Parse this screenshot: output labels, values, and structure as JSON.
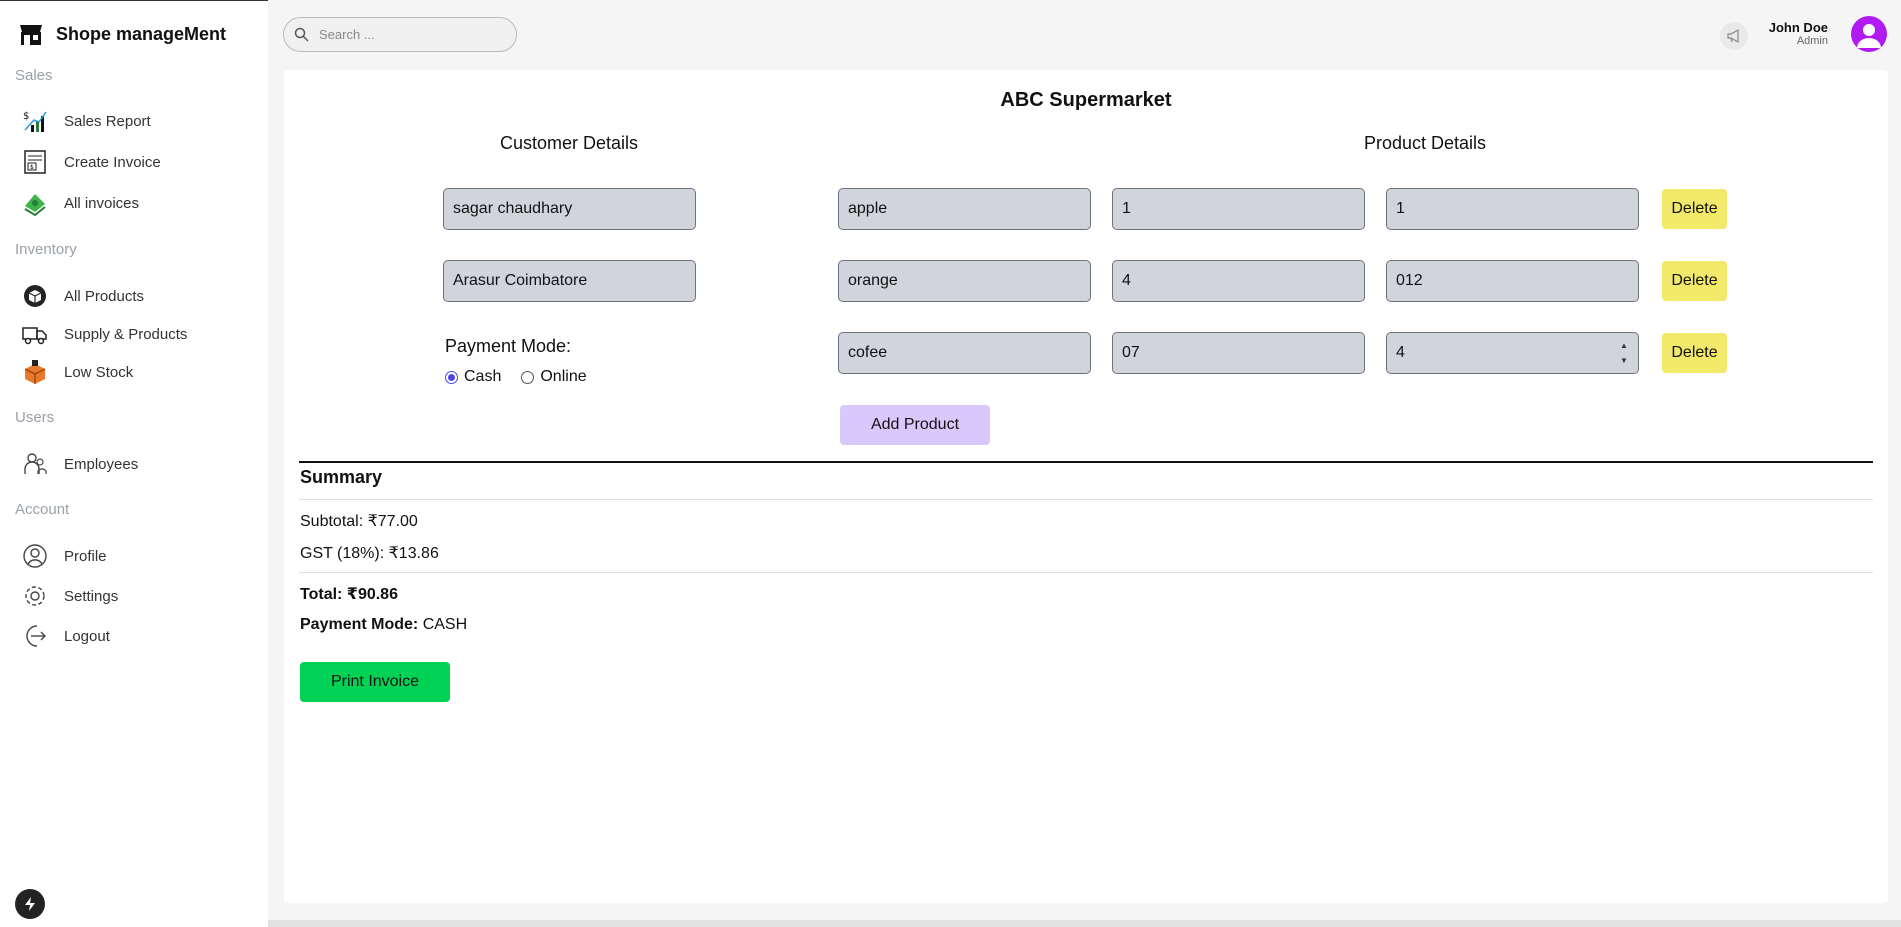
{
  "app": {
    "title": "Shope manageMent"
  },
  "search": {
    "placeholder": "Search ..."
  },
  "sidebar": {
    "sections": [
      {
        "label": "Sales",
        "items": [
          {
            "label": "Sales Report",
            "icon": "chart-bars-icon"
          },
          {
            "label": "Create Invoice",
            "icon": "invoice-icon"
          },
          {
            "label": "All invoices",
            "icon": "money-stack-icon"
          }
        ]
      },
      {
        "label": "Inventory",
        "items": [
          {
            "label": "All Products",
            "icon": "box-icon"
          },
          {
            "label": "Supply & Products",
            "icon": "truck-icon"
          },
          {
            "label": "Low Stock",
            "icon": "stock-box-icon"
          }
        ]
      },
      {
        "label": "Users",
        "items": [
          {
            "label": "Employees",
            "icon": "users-icon"
          }
        ]
      },
      {
        "label": "Account",
        "items": [
          {
            "label": "Profile",
            "icon": "user-circle-icon"
          },
          {
            "label": "Settings",
            "icon": "gear-icon"
          },
          {
            "label": "Logout",
            "icon": "logout-icon"
          }
        ]
      }
    ]
  },
  "user": {
    "name": "John Doe",
    "role": "Admin"
  },
  "invoice": {
    "store_name": "ABC Supermarket",
    "customer_heading": "Customer Details",
    "product_heading": "Product Details",
    "customer_name": "sagar chaudhary",
    "customer_address": "Arasur Coimbatore",
    "payment_mode_label": "Payment Mode:",
    "payment_options": [
      "Cash",
      "Online"
    ],
    "payment_selected": "Cash",
    "products": [
      {
        "name": "apple",
        "price": "1",
        "qty": "1"
      },
      {
        "name": "orange",
        "price": "4",
        "qty": "012"
      },
      {
        "name": "cofee",
        "price": "07",
        "qty": "4"
      }
    ],
    "delete_label": "Delete",
    "add_product_label": "Add Product"
  },
  "summary": {
    "title": "Summary",
    "subtotal": "Subtotal: ₹77.00",
    "gst": "GST (18%): ₹13.86",
    "total": "Total: ₹90.86",
    "payment_mode_label": "Payment Mode:",
    "payment_mode_value": "CASH",
    "print_label": "Print Invoice"
  },
  "colors": {
    "accent": "#b11bf2",
    "delete": "#f2e96b",
    "add": "#d9c8fb",
    "print": "#00d255"
  }
}
